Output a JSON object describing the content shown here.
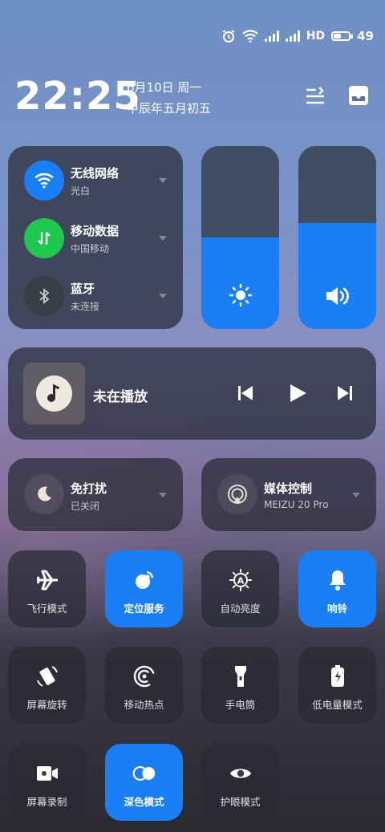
{
  "status_bar": {
    "icons": [
      "alarm-icon",
      "wifi-icon",
      "signal-icon-1",
      "signal-icon-2",
      "battery-icon"
    ],
    "network_type": "HD",
    "battery_level": 49,
    "battery_text": "49"
  },
  "header": {
    "time": "22:25",
    "date": "6月10日 周一",
    "lunar_date": "甲辰年五月初五",
    "edit_icon": "edit-list-icon",
    "notification_icon": "inbox-icon"
  },
  "connectivity": {
    "wifi": {
      "title": "无线网络",
      "sub": "光白",
      "color": "#1a7ef7"
    },
    "mobile": {
      "title": "移动数据",
      "sub": "中国移动",
      "color": "#1ec84c"
    },
    "bluetooth": {
      "title": "蓝牙",
      "sub": "未连接",
      "color": "#3b3d47"
    }
  },
  "sliders": {
    "brightness": {
      "level_percent": 50,
      "icon": "brightness-icon"
    },
    "volume": {
      "level_percent": 58,
      "icon": "volume-icon"
    }
  },
  "media": {
    "status": "未在播放",
    "icon": "music-note-icon"
  },
  "dnd": {
    "title": "免打扰",
    "sub": "已关闭"
  },
  "media_control": {
    "title": "媒体控制",
    "sub": "MEIZU 20 Pro"
  },
  "tiles": [
    {
      "label": "飞行模式",
      "icon": "airplane-icon",
      "on": false
    },
    {
      "label": "定位服务",
      "icon": "location-icon",
      "on": true
    },
    {
      "label": "自动亮度",
      "icon": "auto-brightness-icon",
      "on": false
    },
    {
      "label": "响铃",
      "icon": "bell-icon",
      "on": true
    },
    {
      "label": "屏幕旋转",
      "icon": "rotate-icon",
      "on": false
    },
    {
      "label": "移动热点",
      "icon": "hotspot-icon",
      "on": false
    },
    {
      "label": "手电筒",
      "icon": "flashlight-icon",
      "on": false
    },
    {
      "label": "低电量模式",
      "icon": "battery-saver-icon",
      "on": false
    },
    {
      "label": "屏幕录制",
      "icon": "screen-record-icon",
      "on": false
    },
    {
      "label": "深色模式",
      "icon": "dark-mode-icon",
      "on": true
    },
    {
      "label": "护眼模式",
      "icon": "eye-icon",
      "on": false
    }
  ],
  "colors": {
    "accent": "#1a7ef7",
    "green": "#1ec84c"
  }
}
